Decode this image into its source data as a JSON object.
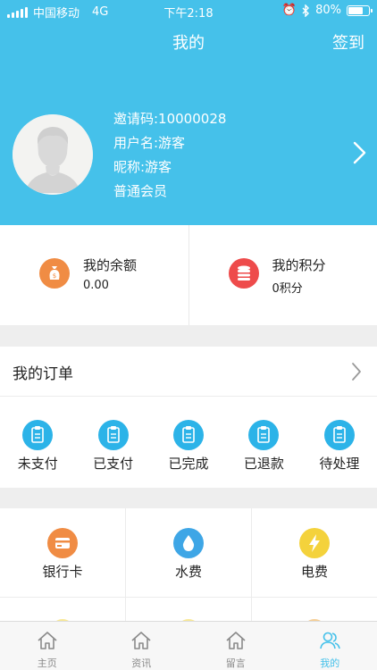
{
  "status_bar": {
    "carrier": "中国移动",
    "network": "4G",
    "time": "下午2:18",
    "battery": "80%",
    "battery_level": 0.8
  },
  "header": {
    "title": "我的",
    "signin_label": "签到"
  },
  "profile": {
    "invite_code": "邀请码:10000028",
    "username": "用户名:游客",
    "nickname": "昵称:游客",
    "level": "普通会员"
  },
  "assets": {
    "balance": {
      "label": "我的余额",
      "value": "0.00",
      "icon": "money-bag-icon",
      "color": "#f08c44"
    },
    "points": {
      "label": "我的积分",
      "value": "0积分",
      "icon": "coins-icon",
      "color": "#ee4b4b"
    }
  },
  "orders": {
    "title": "我的订单",
    "items": [
      {
        "label": "未支付",
        "icon": "clipboard-icon"
      },
      {
        "label": "已支付",
        "icon": "clipboard-icon"
      },
      {
        "label": "已完成",
        "icon": "clipboard-icon"
      },
      {
        "label": "已退款",
        "icon": "clipboard-icon"
      },
      {
        "label": "待处理",
        "icon": "clipboard-icon"
      }
    ],
    "icon_color": "#2cb3e8"
  },
  "services": [
    {
      "label": "银行卡",
      "icon": "bank-card-icon",
      "color": "#f08c44"
    },
    {
      "label": "水费",
      "icon": "water-drop-icon",
      "color": "#3ea6e6"
    },
    {
      "label": "电费",
      "icon": "lightning-icon",
      "color": "#f4d23c"
    }
  ],
  "tabbar": {
    "items": [
      {
        "label": "主页",
        "icon": "home-icon"
      },
      {
        "label": "资讯",
        "icon": "home-icon"
      },
      {
        "label": "留言",
        "icon": "home-icon"
      },
      {
        "label": "我的",
        "icon": "user-group-icon"
      }
    ],
    "active_color": "#45c1ea"
  }
}
